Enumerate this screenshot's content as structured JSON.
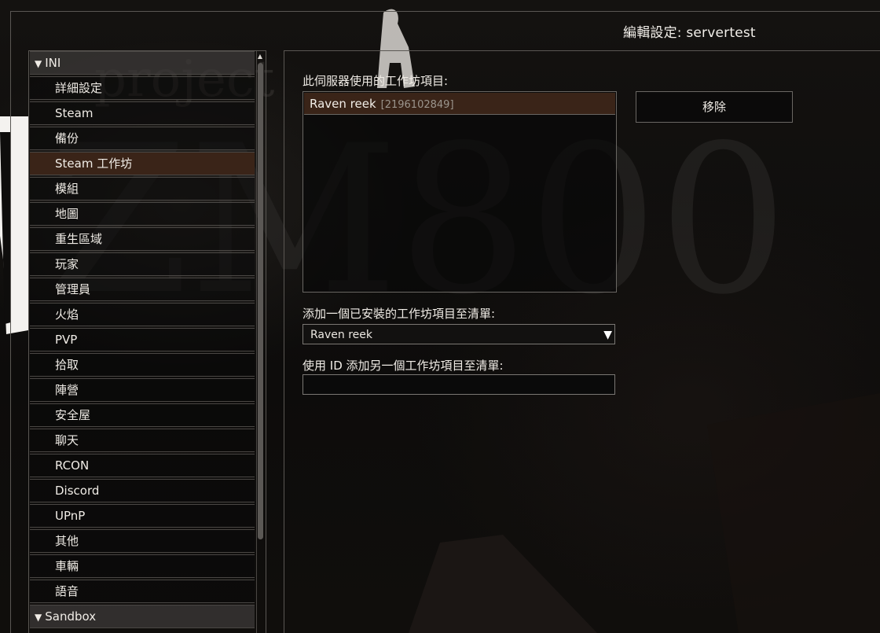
{
  "window": {
    "title": "編輯設定: servertest"
  },
  "sidebar": {
    "groups": [
      {
        "label": "INI",
        "items": [
          "詳細設定",
          "Steam",
          "備份",
          "Steam 工作坊",
          "模組",
          "地圖",
          "重生區域",
          "玩家",
          "管理員",
          "火焰",
          "PVP",
          "拾取",
          "陣營",
          "安全屋",
          "聊天",
          "RCON",
          "Discord",
          "UPnP",
          "其他",
          "車輛",
          "語音"
        ]
      },
      {
        "label": "Sandbox",
        "items": []
      }
    ],
    "selected": "Steam 工作坊",
    "scroll_up_glyph": "▲"
  },
  "main": {
    "workshop_list_label": "此伺服器使用的工作坊項目:",
    "workshop_items": [
      {
        "name": "Raven reek",
        "id": "[2196102849]"
      }
    ],
    "remove_button": "移除",
    "add_installed_label": "添加一個已安裝的工作坊項目至清單:",
    "installed_selected": "Raven reek",
    "add_by_id_label": "使用 ID 添加另一個工作坊項目至清單:",
    "add_by_id_value": ""
  },
  "colors": {
    "selected_row": "#3a2418",
    "border": "#5a5753",
    "background": "#0b0a09"
  }
}
